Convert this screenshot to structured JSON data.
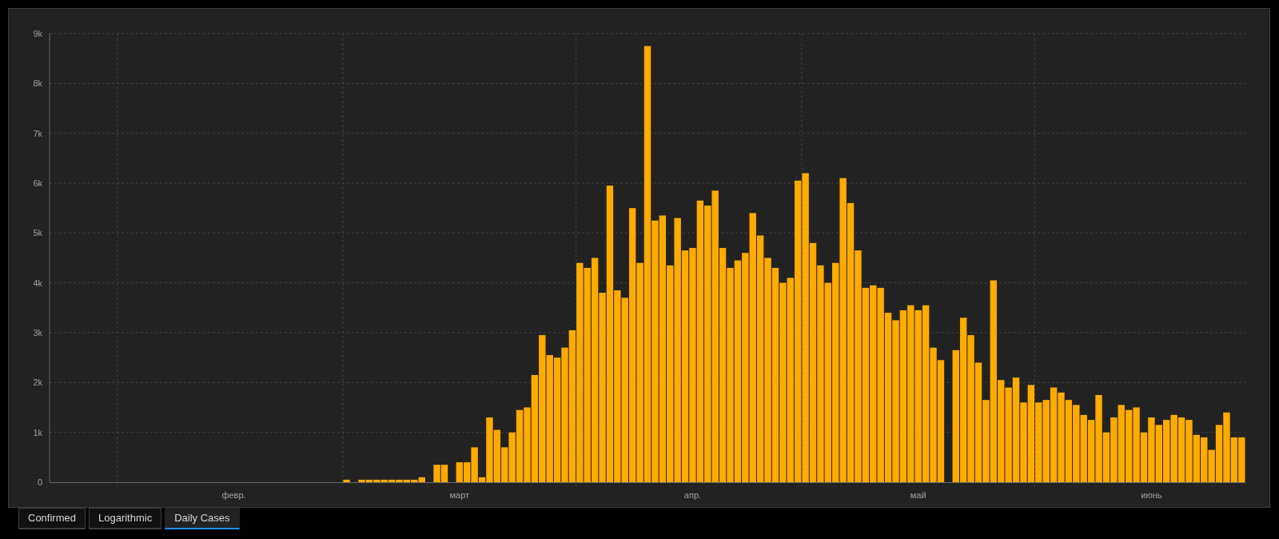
{
  "chart": {
    "chart_data": {
      "type": "bar",
      "grid": true,
      "ylim": [
        0,
        9000
      ],
      "yticks": [
        {
          "value": 0,
          "label": "0"
        },
        {
          "value": 1000,
          "label": "1k"
        },
        {
          "value": 2000,
          "label": "2k"
        },
        {
          "value": 3000,
          "label": "3k"
        },
        {
          "value": 4000,
          "label": "4k"
        },
        {
          "value": 5000,
          "label": "5k"
        },
        {
          "value": 6000,
          "label": "6k"
        },
        {
          "value": 7000,
          "label": "7k"
        },
        {
          "value": 8000,
          "label": "8k"
        },
        {
          "value": 9000,
          "label": "9k"
        }
      ],
      "categories": [
        null,
        null,
        null,
        null,
        null,
        null,
        null,
        null,
        null,
        null,
        null,
        null,
        null,
        null,
        null,
        null,
        null,
        null,
        null,
        null,
        null,
        null,
        null,
        null,
        "февр.",
        null,
        null,
        null,
        null,
        null,
        null,
        null,
        null,
        null,
        null,
        null,
        null,
        null,
        null,
        null,
        null,
        null,
        null,
        null,
        null,
        null,
        null,
        null,
        null,
        null,
        null,
        null,
        null,
        null,
        "март",
        null,
        null,
        null,
        null,
        null,
        null,
        null,
        null,
        null,
        null,
        null,
        null,
        null,
        null,
        null,
        null,
        null,
        null,
        null,
        null,
        null,
        null,
        null,
        null,
        null,
        null,
        null,
        null,
        null,
        null,
        "апр.",
        null,
        null,
        null,
        null,
        null,
        null,
        null,
        null,
        null,
        null,
        null,
        null,
        null,
        null,
        null,
        null,
        null,
        null,
        null,
        null,
        null,
        null,
        null,
        null,
        null,
        null,
        null,
        null,
        null,
        "май",
        null,
        null,
        null,
        null,
        null,
        null,
        null,
        null,
        null,
        null,
        null,
        null,
        null,
        null,
        null,
        null,
        null,
        null,
        null,
        null,
        null,
        null,
        null,
        null,
        null,
        null,
        null,
        null,
        null,
        null,
        "июнь",
        null,
        null,
        null,
        null,
        null,
        null,
        null,
        null,
        null,
        null,
        null,
        null
      ],
      "series": [
        {
          "color": "#ffab00",
          "values": [
            0,
            0,
            0,
            0,
            0,
            0,
            0,
            0,
            0,
            0,
            0,
            0,
            0,
            0,
            0,
            0,
            0,
            0,
            0,
            0,
            0,
            0,
            0,
            0,
            0,
            0,
            0,
            0,
            0,
            0,
            0,
            0,
            0,
            0,
            0,
            0,
            0,
            0,
            0,
            50,
            0,
            50,
            50,
            50,
            50,
            50,
            50,
            50,
            50,
            100,
            0,
            350,
            350,
            0,
            400,
            400,
            700,
            100,
            1300,
            1050,
            700,
            1000,
            1450,
            1500,
            2150,
            2950,
            2550,
            2500,
            2700,
            3050,
            4400,
            4300,
            4500,
            3800,
            5950,
            3850,
            3700,
            5500,
            4400,
            8750,
            5250,
            5350,
            4350,
            5300,
            4650,
            4700,
            5650,
            5550,
            5850,
            4700,
            4300,
            4450,
            4600,
            5400,
            4950,
            4500,
            4300,
            4000,
            4100,
            6050,
            6200,
            4800,
            4350,
            4000,
            4400,
            6100,
            5600,
            4650,
            3900,
            3950,
            3900,
            3400,
            3250,
            3450,
            3550,
            3450,
            3550,
            2700,
            2450,
            0,
            2650,
            3300,
            2950,
            2400,
            1650,
            4050,
            2050,
            1900,
            2100,
            1600,
            1950,
            1600,
            1650,
            1900,
            1800,
            1650,
            1550,
            1350,
            1250,
            1750,
            1000,
            1300,
            1550,
            1450,
            1500,
            1000,
            1300,
            1150,
            1250,
            1350,
            1300,
            1250,
            950,
            900,
            650,
            1150,
            1400,
            900,
            900
          ]
        }
      ]
    }
  },
  "tabs": [
    {
      "label": "Confirmed",
      "selected": false
    },
    {
      "label": "Logarithmic",
      "selected": false
    },
    {
      "label": "Daily Cases",
      "selected": true
    }
  ]
}
